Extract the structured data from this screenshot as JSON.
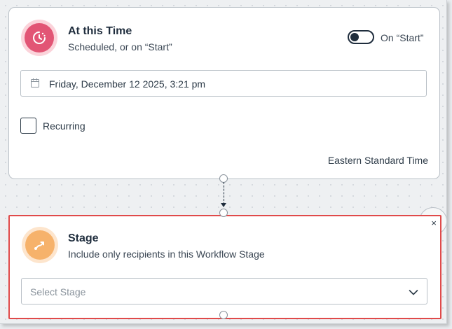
{
  "trigger_card": {
    "title": "At this Time",
    "subtitle": "Scheduled, or on “Start”",
    "toggle_label": "On “Start”",
    "toggle_on": false,
    "date_value": "Friday, December 12 2025, 3:21 pm",
    "recurring_label": "Recurring",
    "recurring_checked": false,
    "timezone": "Eastern Standard Time",
    "icon": "clock-icon",
    "accent_color": "#e25575"
  },
  "stage_card": {
    "title": "Stage",
    "subtitle": "Include only recipients in this Workflow Stage",
    "select_placeholder": "Select Stage",
    "close_label": "×",
    "icon": "route-icon",
    "accent_color": "#f6b26b",
    "highlight_color": "#e04a4a"
  }
}
